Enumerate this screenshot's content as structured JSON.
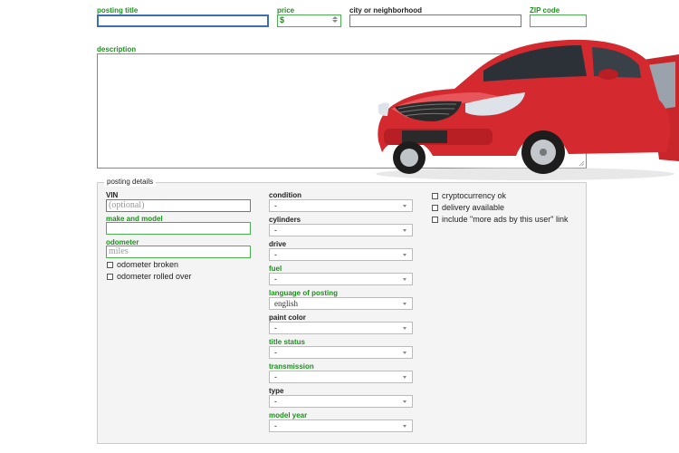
{
  "top_fields": {
    "posting_title": {
      "label": "posting title",
      "value": ""
    },
    "price": {
      "label": "price",
      "currency_symbol": "$",
      "value": ""
    },
    "city": {
      "label": "city or neighborhood",
      "value": ""
    },
    "zip": {
      "label": "ZIP code",
      "value": ""
    }
  },
  "description": {
    "label": "description",
    "value": ""
  },
  "posting_details": {
    "legend": "posting details",
    "left_column": {
      "vin": {
        "label": "VIN",
        "placeholder": "(optional)"
      },
      "make_model": {
        "label": "make and model",
        "value": ""
      },
      "odometer": {
        "label": "odometer",
        "placeholder": "miles"
      },
      "checkboxes": [
        "odometer broken",
        "odometer rolled over"
      ]
    },
    "middle_column": [
      {
        "label": "condition",
        "value": "-",
        "required": false
      },
      {
        "label": "cylinders",
        "value": "-",
        "required": false
      },
      {
        "label": "drive",
        "value": "-",
        "required": false
      },
      {
        "label": "fuel",
        "value": "-",
        "required": true
      },
      {
        "label": "language of posting",
        "value": "english",
        "required": true
      },
      {
        "label": "paint color",
        "value": "-",
        "required": false
      },
      {
        "label": "title status",
        "value": "-",
        "required": true
      },
      {
        "label": "transmission",
        "value": "-",
        "required": true
      },
      {
        "label": "type",
        "value": "-",
        "required": false
      },
      {
        "label": "model year",
        "value": "-",
        "required": true
      }
    ],
    "right_column": {
      "checkboxes": [
        "cryptocurrency ok",
        "delivery available",
        "include \"more ads by this user\" link"
      ]
    }
  },
  "image": {
    "subject": "red sedan car with open driver door"
  },
  "colors": {
    "required_label": "#1e8f1e",
    "focus_border": "#3b6fb6",
    "car_body": "#d42a2f"
  }
}
